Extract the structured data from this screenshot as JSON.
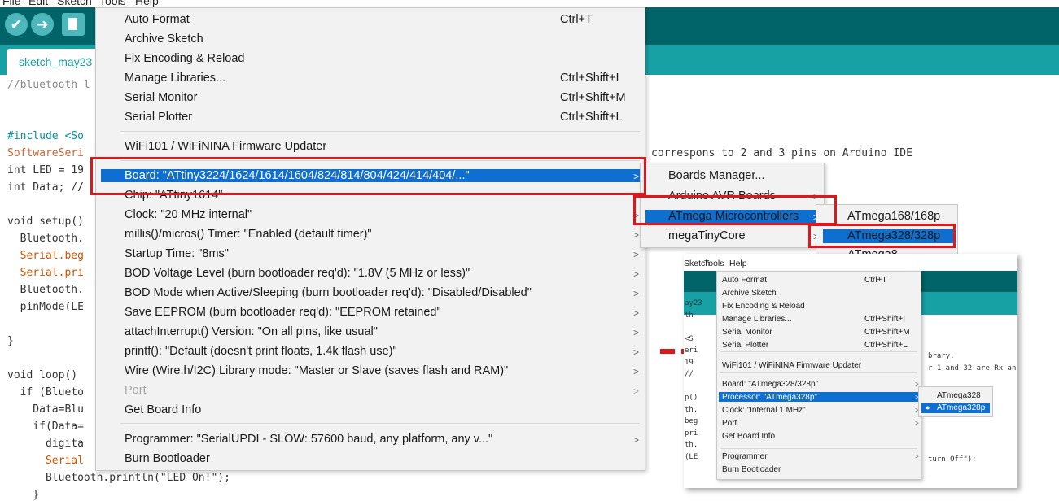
{
  "menubar": [
    "File",
    "Edit",
    "Sketch",
    "Tools",
    "Help"
  ],
  "tab": {
    "label": "sketch_may23"
  },
  "code_lines": [
    {
      "text": "//bluetooth l",
      "cls": "c-com"
    },
    {
      "text": "",
      "cls": ""
    },
    {
      "text": "",
      "cls": ""
    },
    {
      "text": "#include <So",
      "cls": "c-kw"
    },
    {
      "text": "SoftwareSeri",
      "cls": "c-ty"
    },
    {
      "text": "int LED = 19",
      "cls": ""
    },
    {
      "text": "int Data; //",
      "cls": ""
    },
    {
      "text": "",
      "cls": ""
    },
    {
      "text": "void setup()",
      "cls": ""
    },
    {
      "text": "  Bluetooth.",
      "cls": ""
    },
    {
      "text": "  Serial.beg",
      "cls": "c-fn"
    },
    {
      "text": "  Serial.pri",
      "cls": "c-fn"
    },
    {
      "text": "  Bluetooth.",
      "cls": ""
    },
    {
      "text": "  pinMode(LE",
      "cls": ""
    },
    {
      "text": "",
      "cls": ""
    },
    {
      "text": "}",
      "cls": ""
    },
    {
      "text": "",
      "cls": ""
    },
    {
      "text": "void loop()",
      "cls": ""
    },
    {
      "text": "  if (Blueto",
      "cls": ""
    },
    {
      "text": "    Data=Blu",
      "cls": ""
    },
    {
      "text": "    if(Data=",
      "cls": ""
    },
    {
      "text": "      digita",
      "cls": ""
    },
    {
      "text": "      Serial",
      "cls": "c-fn"
    },
    {
      "text": "      Bluetooth.println(\"LED On!\");",
      "cls": ""
    },
    {
      "text": "    }",
      "cls": ""
    }
  ],
  "code_right": "correspons to 2 and 3 pins on Arduino IDE",
  "tools_menu": {
    "items": [
      {
        "label": "Auto Format",
        "shortcut": "Ctrl+T"
      },
      {
        "label": "Archive Sketch",
        "shortcut": ""
      },
      {
        "label": "Fix Encoding & Reload",
        "shortcut": ""
      },
      {
        "label": "Manage Libraries...",
        "shortcut": "Ctrl+Shift+I"
      },
      {
        "label": "Serial Monitor",
        "shortcut": "Ctrl+Shift+M"
      },
      {
        "label": "Serial Plotter",
        "shortcut": "Ctrl+Shift+L"
      },
      {
        "label": "WiFi101 / WiFiNINA Firmware Updater",
        "shortcut": ""
      },
      {
        "label": "Board: \"ATtiny3224/1624/1614/1604/824/814/804/424/414/404/...\"",
        "shortcut": ""
      },
      {
        "label": "Chip: \"ATtiny1614\"",
        "shortcut": ""
      },
      {
        "label": "Clock: \"20 MHz internal\"",
        "shortcut": ""
      },
      {
        "label": "millis()/micros() Timer: \"Enabled (default timer)\"",
        "shortcut": ""
      },
      {
        "label": "Startup Time: \"8ms\"",
        "shortcut": ""
      },
      {
        "label": "BOD Voltage Level (burn bootloader req'd): \"1.8V (5 MHz or less)\"",
        "shortcut": ""
      },
      {
        "label": "BOD Mode when Active/Sleeping (burn bootloader req'd): \"Disabled/Disabled\"",
        "shortcut": ""
      },
      {
        "label": "Save EEPROM (burn bootloader req'd): \"EEPROM retained\"",
        "shortcut": ""
      },
      {
        "label": "attachInterrupt() Version: \"On all pins, like usual\"",
        "shortcut": ""
      },
      {
        "label": "printf(): \"Default (doesn't print floats, 1.4k flash use)\"",
        "shortcut": ""
      },
      {
        "label": "Wire (Wire.h/I2C) Library mode: \"Master or Slave (saves flash and RAM)\"",
        "shortcut": ""
      },
      {
        "label": "Port",
        "shortcut": ""
      },
      {
        "label": "Get Board Info",
        "shortcut": ""
      },
      {
        "label": "Programmer: \"SerialUPDI - SLOW: 57600 baud, any platform, any v...\"",
        "shortcut": ""
      },
      {
        "label": "Burn Bootloader",
        "shortcut": ""
      }
    ]
  },
  "board_submenu": [
    "Boards Manager...",
    "Arduino AVR Boards",
    "ATmega Microcontrollers",
    "megaTinyCore"
  ],
  "mcu_submenu": [
    "ATmega168/168p",
    "ATmega328/328p",
    "ATmega8"
  ],
  "inset": {
    "menubar": [
      "Sketch",
      "Tools",
      "Help"
    ],
    "code": [
      "ay23",
      "th",
      "",
      "<S",
      "eri",
      "19",
      "//",
      "",
      "p()",
      "th.",
      "beg",
      "pri",
      "th.",
      "(LE"
    ],
    "code_right": [
      "brary.",
      "r 1 and 32 are Rx an",
      "turn Off\");"
    ],
    "menu": [
      {
        "label": "Auto Format",
        "shortcut": "Ctrl+T"
      },
      {
        "label": "Archive Sketch",
        "shortcut": ""
      },
      {
        "label": "Fix Encoding & Reload",
        "shortcut": ""
      },
      {
        "label": "Manage Libraries...",
        "shortcut": "Ctrl+Shift+I"
      },
      {
        "label": "Serial Monitor",
        "shortcut": "Ctrl+Shift+M"
      },
      {
        "label": "Serial Plotter",
        "shortcut": "Ctrl+Shift+L"
      },
      {
        "label": "WiFi101 / WiFiNINA Firmware Updater",
        "shortcut": ""
      },
      {
        "label": "Board: \"ATmega328/328p\"",
        "shortcut": ""
      },
      {
        "label": "Processor: \"ATmega328p\"",
        "shortcut": ""
      },
      {
        "label": "Clock: \"Internal 1 MHz\"",
        "shortcut": ""
      },
      {
        "label": "Port",
        "shortcut": ""
      },
      {
        "label": "Get Board Info",
        "shortcut": ""
      },
      {
        "label": "Programmer",
        "shortcut": ""
      },
      {
        "label": "Burn Bootloader",
        "shortcut": ""
      }
    ],
    "processor_submenu": [
      "ATmega328",
      "ATmega328p"
    ]
  }
}
